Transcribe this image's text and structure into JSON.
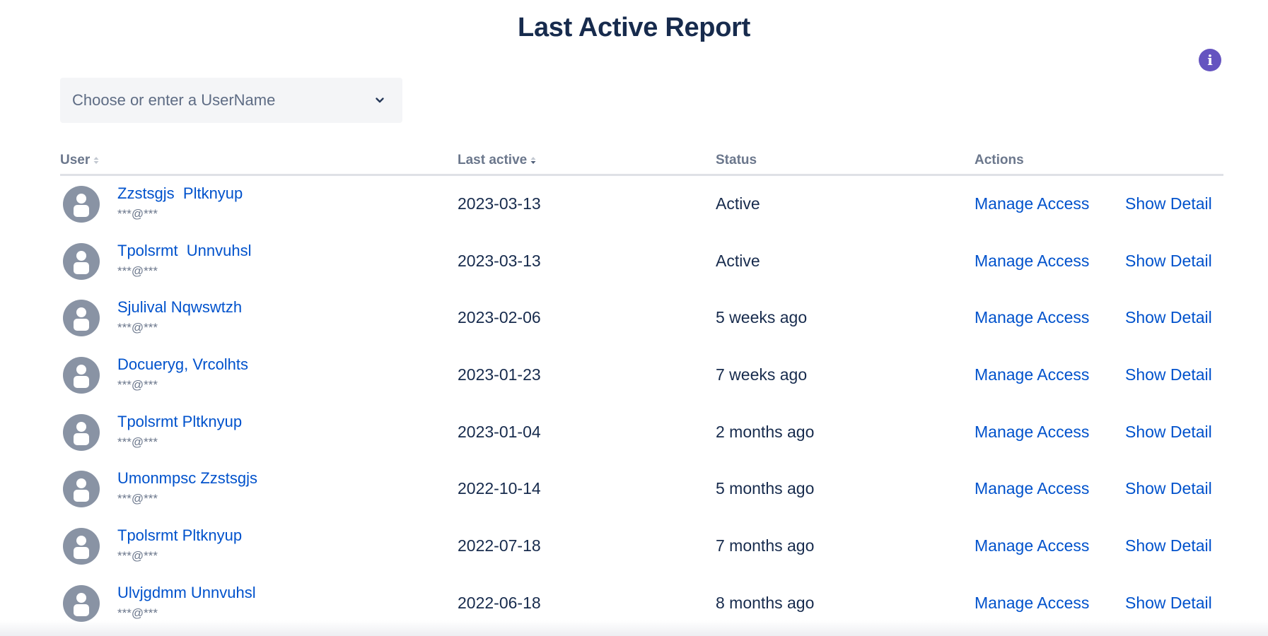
{
  "page": {
    "title": "Last Active Report"
  },
  "info_button": {
    "label": "i",
    "color": "#6554C0"
  },
  "user_select": {
    "placeholder": "Choose or enter a UserName"
  },
  "table": {
    "columns": [
      {
        "label": "User",
        "sortable": true
      },
      {
        "label": "Last active",
        "sortable": true
      },
      {
        "label": "Status",
        "sortable": false
      },
      {
        "label": "Actions",
        "sortable": false
      }
    ],
    "rows": [
      {
        "name": "Zzstsgjs  Pltknyup",
        "email": "***@***",
        "last_active": "2023-03-13",
        "status": "Active",
        "action1": "Manage Access",
        "action2": "Show Detail"
      },
      {
        "name": "Tpolsrmt  Unnvuhsl",
        "email": "***@***",
        "last_active": "2023-03-13",
        "status": "Active",
        "action1": "Manage Access",
        "action2": "Show Detail"
      },
      {
        "name": "Sjulival Nqwswtzh",
        "email": "***@***",
        "last_active": "2023-02-06",
        "status": "5 weeks ago",
        "action1": "Manage Access",
        "action2": "Show Detail"
      },
      {
        "name": "Docueryg, Vrcolhts",
        "email": "***@***",
        "last_active": "2023-01-23",
        "status": "7 weeks ago",
        "action1": "Manage Access",
        "action2": "Show Detail"
      },
      {
        "name": "Tpolsrmt Pltknyup",
        "email": "***@***",
        "last_active": "2023-01-04",
        "status": "2 months ago",
        "action1": "Manage Access",
        "action2": "Show Detail"
      },
      {
        "name": "Umonmpsc Zzstsgjs",
        "email": "***@***",
        "last_active": "2022-10-14",
        "status": "5 months ago",
        "action1": "Manage Access",
        "action2": "Show Detail"
      },
      {
        "name": "Tpolsrmt Pltknyup",
        "email": "***@***",
        "last_active": "2022-07-18",
        "status": "7 months ago",
        "action1": "Manage Access",
        "action2": "Show Detail"
      },
      {
        "name": "Ulvjgdmm Unnvuhsl",
        "email": "***@***",
        "last_active": "2022-06-18",
        "status": "8 months ago",
        "action1": "Manage Access",
        "action2": "Show Detail"
      }
    ]
  },
  "colors": {
    "link": "#0052CC",
    "text": "#172B4D",
    "muted": "#6B778C",
    "avatar": "#8993A4"
  }
}
